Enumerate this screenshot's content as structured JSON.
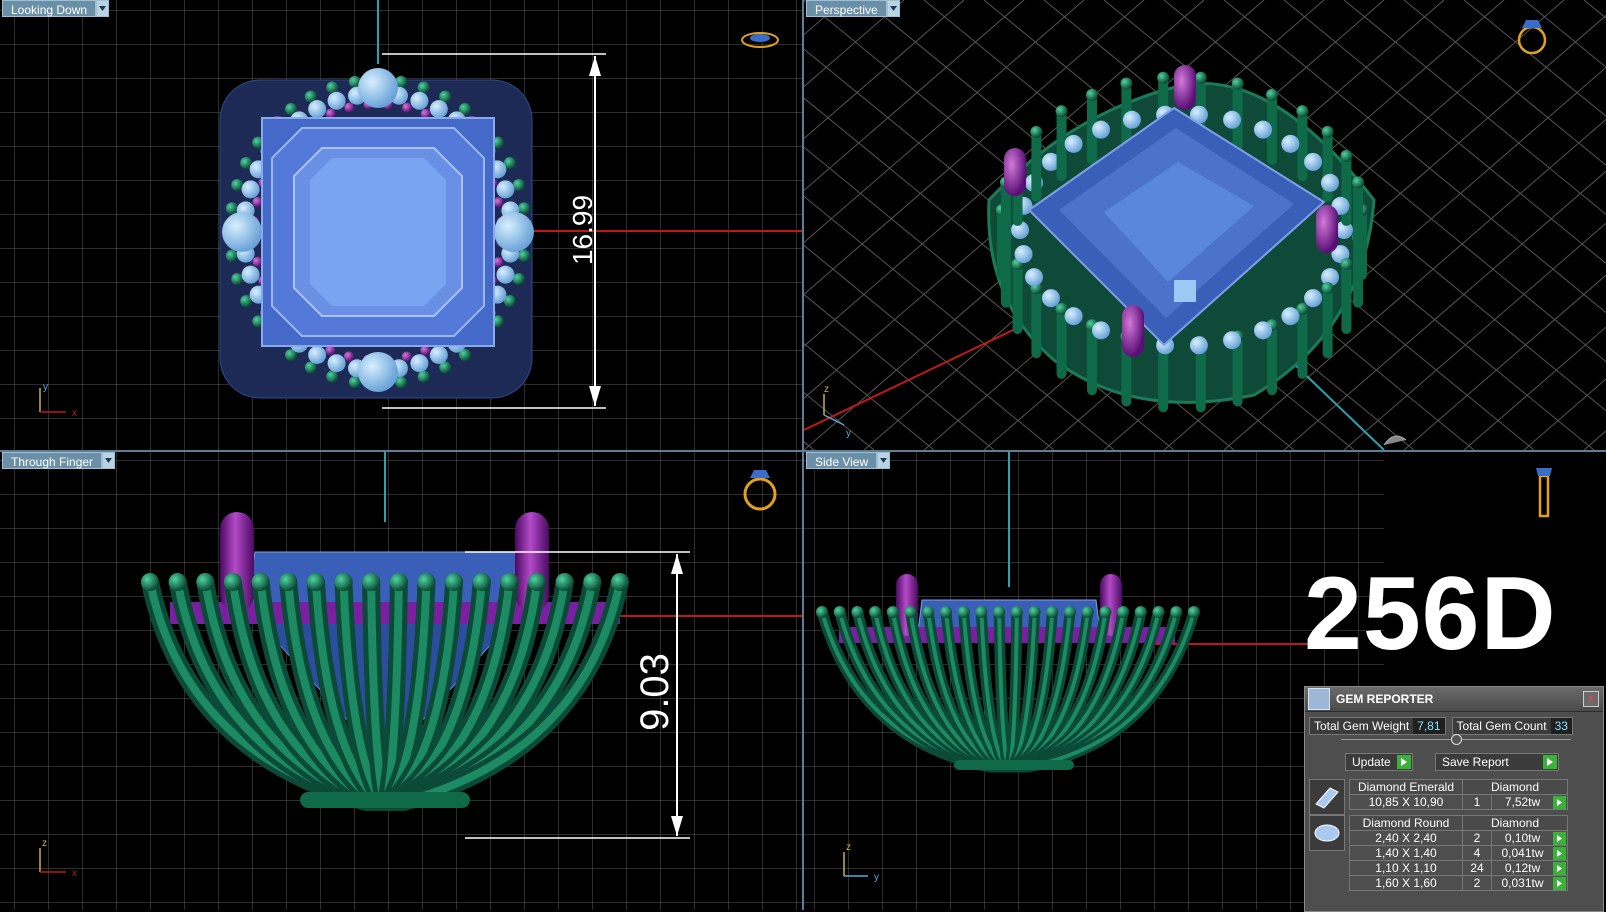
{
  "viewports": {
    "top_left": {
      "label": "Looking Down",
      "dimension": "16.99"
    },
    "top_right": {
      "label": "Perspective"
    },
    "bottom_left": {
      "label": "Through Finger",
      "dimension": "9.03"
    },
    "bottom_right": {
      "label": "Side View"
    }
  },
  "model_code": "256D",
  "colors": {
    "grid": "#595959",
    "prong": "#0c5e44",
    "accent_prong": "#7b1fa2",
    "stone": "#5d86d8",
    "axis_red": "#c01818",
    "axis_cyan": "#2aa3b0"
  },
  "gem_reporter": {
    "title": "GEM REPORTER",
    "close": "x",
    "total_weight_label": "Total Gem Weight",
    "total_weight_value": "7,81",
    "total_count_label": "Total Gem Count",
    "total_count_value": "33",
    "update_label": "Update",
    "save_label": "Save Report",
    "groups": [
      {
        "shape": "Diamond Emerald",
        "material": "Diamond",
        "rows": [
          {
            "size": "10,85 X 10,90",
            "count": "1",
            "weight": "7,52tw"
          }
        ]
      },
      {
        "shape": "Diamond Round",
        "material": "Diamond",
        "rows": [
          {
            "size": "2,40 X 2,40",
            "count": "2",
            "weight": "0,10tw"
          },
          {
            "size": "1,40 X 1,40",
            "count": "4",
            "weight": "0,041tw"
          },
          {
            "size": "1,10 X 1,10",
            "count": "24",
            "weight": "0,12tw"
          },
          {
            "size": "1,60 X 1,60",
            "count": "2",
            "weight": "0,031tw"
          }
        ]
      }
    ]
  },
  "axes": {
    "x": "x",
    "y": "y",
    "z": "z"
  }
}
